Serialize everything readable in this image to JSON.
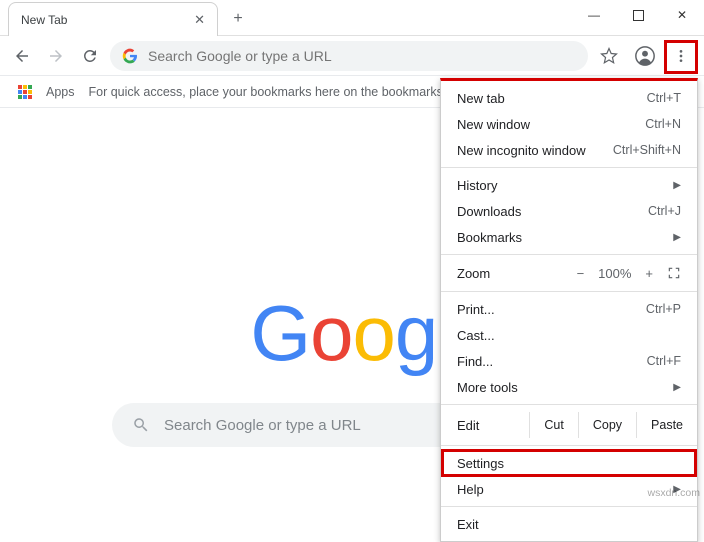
{
  "window": {
    "tab_title": "New Tab",
    "minimize": "—",
    "maximize": "▢",
    "close": "✕"
  },
  "toolbar": {
    "omnibox_placeholder": "Search Google or type a URL"
  },
  "bookmarks": {
    "apps_label": "Apps",
    "hint": "For quick access, place your bookmarks here on the bookmarks ba"
  },
  "ntp": {
    "search_placeholder": "Search Google or type a URL"
  },
  "menu": {
    "new_tab": {
      "label": "New tab",
      "shortcut": "Ctrl+T"
    },
    "new_window": {
      "label": "New window",
      "shortcut": "Ctrl+N"
    },
    "incognito": {
      "label": "New incognito window",
      "shortcut": "Ctrl+Shift+N"
    },
    "history": {
      "label": "History"
    },
    "downloads": {
      "label": "Downloads",
      "shortcut": "Ctrl+J"
    },
    "bookmarks": {
      "label": "Bookmarks"
    },
    "zoom": {
      "label": "Zoom",
      "minus": "−",
      "value": "100%",
      "plus": "+"
    },
    "print": {
      "label": "Print...",
      "shortcut": "Ctrl+P"
    },
    "cast": {
      "label": "Cast..."
    },
    "find": {
      "label": "Find...",
      "shortcut": "Ctrl+F"
    },
    "more_tools": {
      "label": "More tools"
    },
    "edit": {
      "label": "Edit",
      "cut": "Cut",
      "copy": "Copy",
      "paste": "Paste"
    },
    "settings": {
      "label": "Settings"
    },
    "help": {
      "label": "Help"
    },
    "exit": {
      "label": "Exit"
    }
  },
  "watermark": "wsxdn.com"
}
